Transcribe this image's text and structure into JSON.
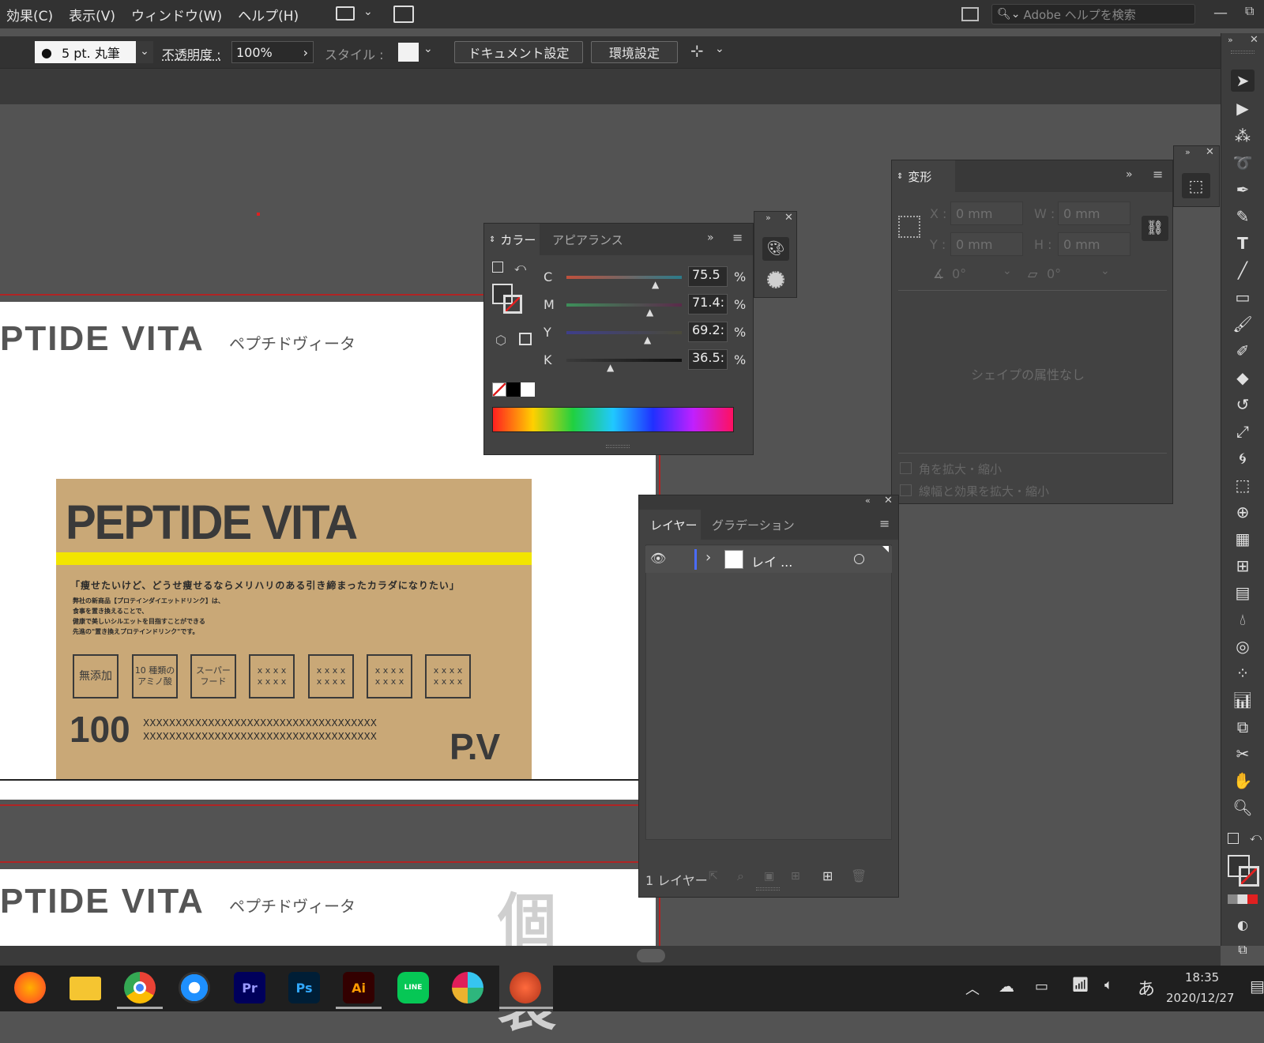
{
  "menu": {
    "items": [
      "効果(C)",
      "表示(V)",
      "ウィンドウ(W)",
      "ヘルプ(H)"
    ],
    "search_placeholder": "Adobe ヘルプを検索"
  },
  "control_bar": {
    "brush": "5 pt. 丸筆",
    "opacity_label": "不透明度 :",
    "opacity_value": "100%",
    "style_label": "スタイル :",
    "doc_settings": "ドキュメント設定",
    "preferences": "環境設定"
  },
  "color_panel": {
    "tabs": [
      "カラー",
      "アピアランス"
    ],
    "channels": [
      {
        "label": "C",
        "value": "75.5",
        "unit": "%"
      },
      {
        "label": "M",
        "value": "71.4:",
        "unit": "%"
      },
      {
        "label": "Y",
        "value": "69.2:",
        "unit": "%"
      },
      {
        "label": "K",
        "value": "36.5:",
        "unit": "%"
      }
    ],
    "colors": {
      "c_track": "#c0503c",
      "m_track": "#3d8f5a",
      "y_track": "#3e3e8a",
      "k_track": "#111111"
    }
  },
  "transform_panel": {
    "title": "変形",
    "x_label": "X :",
    "x_value": "0 mm",
    "y_label": "Y :",
    "y_value": "0 mm",
    "w_label": "W :",
    "w_value": "0 mm",
    "h_label": "H :",
    "h_value": "0 mm",
    "angle_value": "0°",
    "shear_value": "0°",
    "no_shape": "シェイプの属性なし",
    "scale_corners": "角を拡大・縮小",
    "scale_strokes": "線幅と効果を拡大・縮小"
  },
  "layers_panel": {
    "tabs": [
      "レイヤー",
      "グラデーション"
    ],
    "layer_name": "レイ ...",
    "footer_count": "1 レイヤー"
  },
  "artboard": {
    "brand_title": "PTIDE VITA",
    "brand_kana": "ペプチドヴィータ",
    "card_title": "PEPTIDE VITA",
    "tagline": "「痩せたいけど、どうせ痩せるならメリハリのある引き締まったカラダになりたい」",
    "desc_lines": [
      "弊社の新商品【プロテインダイエットドリンク】は、",
      "食事を置き換えることで、",
      "健康で美しいシルエットを目指すことができる",
      "先進の\"置き換えプロテインドリンク\"です。"
    ],
    "chips": [
      "無添加",
      "10 種類の\nアミノ酸",
      "スーパー\nフード",
      "x x x x\nx x x x",
      "x x x x\nx x x x",
      "x x x x\nx x x x",
      "x x x x\nx x x x"
    ],
    "big_number": "100",
    "xline1": "XXXXXXXXXXXXXXXXXXXXXXXXXXXXXXXXXXXX",
    "xline2": "XXXXXXXXXXXXXXXXXXXXXXXXXXXXXXXXXXXX",
    "pv": "P.V",
    "second_title": "PTIDE VITA",
    "second_kana": "ペプチドヴィータ",
    "second_big": "個　袋",
    "card_bg": "#c9a877",
    "yellow": "#f2e500"
  },
  "taskbar": {
    "apps": [
      "firefox-icon",
      "folder-icon",
      "chrome-icon",
      "camera-icon",
      "Pr",
      "Ps",
      "Ai",
      "LINE",
      "slack-icon",
      "app-icon"
    ],
    "ime": "あ",
    "time": "18:35",
    "date": "2020/12/27"
  }
}
